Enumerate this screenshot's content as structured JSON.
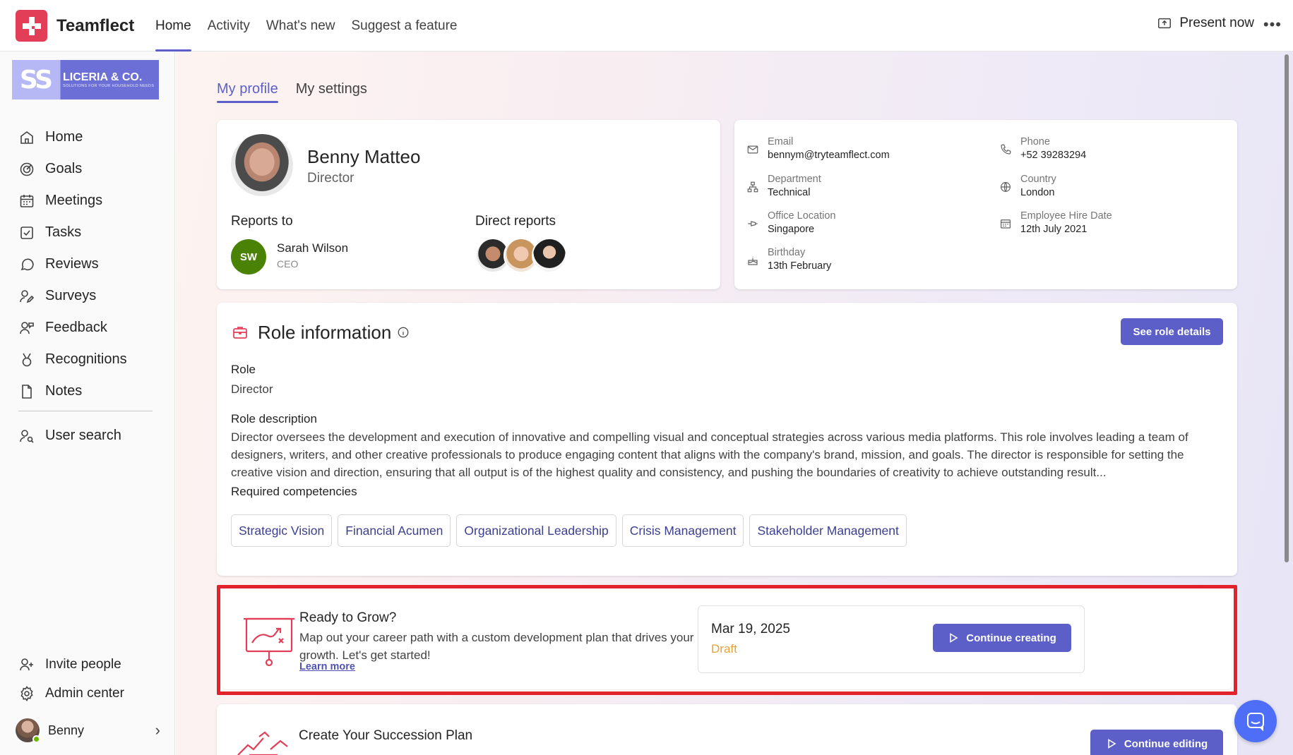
{
  "app": {
    "brand": "Teamflect",
    "nav": [
      "Home",
      "Activity",
      "What's new",
      "Suggest a feature"
    ],
    "active_nav": "Home",
    "present_label": "Present now",
    "more_label": "•••",
    "brand_color": "#e23e57",
    "accent_color": "#5b5fc7"
  },
  "sidebar": {
    "company": {
      "mono": "SS",
      "name": "LICERIA & CO.",
      "tagline": "SOLUTIONS FOR YOUR HOUSEHOLD NEEDS"
    },
    "items": [
      {
        "label": "Home",
        "icon": "home-icon"
      },
      {
        "label": "Goals",
        "icon": "goal-icon"
      },
      {
        "label": "Meetings",
        "icon": "calendar-icon"
      },
      {
        "label": "Tasks",
        "icon": "checkbox-icon"
      },
      {
        "label": "Reviews",
        "icon": "chat-bubble-icon"
      },
      {
        "label": "Surveys",
        "icon": "survey-icon"
      },
      {
        "label": "Feedback",
        "icon": "feedback-icon"
      },
      {
        "label": "Recognitions",
        "icon": "medal-icon"
      },
      {
        "label": "Notes",
        "icon": "note-icon"
      }
    ],
    "user_search": "User search",
    "invite": "Invite people",
    "admin": "Admin center",
    "current_user": "Benny"
  },
  "tabs": [
    "My profile",
    "My settings"
  ],
  "profile": {
    "name": "Benny Matteo",
    "title": "Director",
    "reports_to_label": "Reports to",
    "manager": {
      "initials": "SW",
      "name": "Sarah Wilson",
      "role": "CEO"
    },
    "direct_reports_label": "Direct reports"
  },
  "contact": {
    "email": {
      "label": "Email",
      "value": "bennym@tryteamflect.com"
    },
    "phone": {
      "label": "Phone",
      "value": "+52 39283294"
    },
    "department": {
      "label": "Department",
      "value": "Technical"
    },
    "country": {
      "label": "Country",
      "value": "London"
    },
    "office": {
      "label": "Office Location",
      "value": "Singapore"
    },
    "hire_date": {
      "label": "Employee Hire Date",
      "value": "12th July 2021"
    },
    "birthday": {
      "label": "Birthday",
      "value": "13th February"
    }
  },
  "role": {
    "heading": "Role information",
    "see_details": "See role details",
    "role_label": "Role",
    "role_value": "Director",
    "desc_label": "Role description",
    "desc_value": "Director oversees the development and execution of innovative and compelling visual and conceptual strategies across various media platforms. This role involves leading a team of designers, writers, and other creative professionals to produce engaging content that aligns with the company's brand, mission, and goals. The director is responsible for setting the creative vision and direction, ensuring that all output is of the highest quality and consistency, and pushing the boundaries of creativity to achieve outstanding result...",
    "competencies_label": "Required competencies",
    "competencies": [
      "Strategic Vision",
      "Financial Acumen",
      "Organizational Leadership",
      "Crisis Management",
      "Stakeholder Management"
    ]
  },
  "grow": {
    "title": "Ready to Grow?",
    "desc": "Map out your career path with a custom development plan that drives your growth. Let's get started!",
    "learn_more": "Learn more",
    "date": "Mar 19, 2025",
    "status": "Draft",
    "button": "Continue creating",
    "highlight_color": "#e3232c"
  },
  "succession": {
    "title": "Create Your Succession Plan",
    "button": "Continue editing"
  }
}
